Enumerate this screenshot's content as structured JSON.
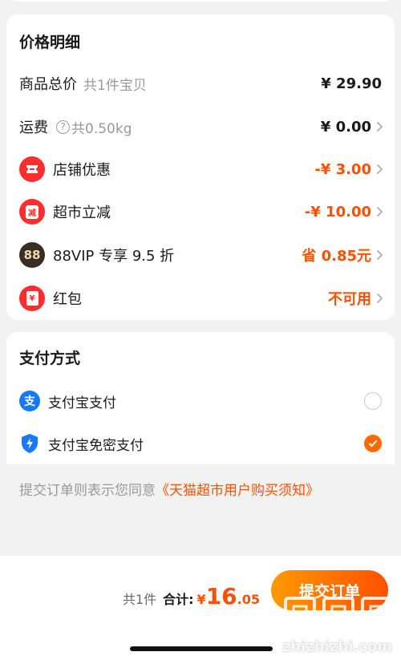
{
  "price_detail": {
    "title": "价格明细",
    "goods_total": {
      "label": "商品总价",
      "sub": "共1件宝贝",
      "amount": "¥ 29.90"
    },
    "shipping": {
      "label": "运费",
      "help_mark": "?",
      "sub": "共0.50kg",
      "amount": "¥ 0.00"
    },
    "store_discount": {
      "label": "店铺优惠",
      "amount": "-¥ 3.00",
      "icon": "ticket-icon"
    },
    "supermarket_discount": {
      "label": "超市立减",
      "badge": "减",
      "amount": "-¥ 10.00",
      "icon": "discount-badge-icon"
    },
    "vip": {
      "label": "88VIP 专享 9.5 折",
      "badge": "88",
      "amount": "省 0.85元",
      "icon": "88vip-icon"
    },
    "red_packet": {
      "label": "红包",
      "badge": "¥",
      "amount": "不可用",
      "icon": "red-packet-icon"
    }
  },
  "payment": {
    "title": "支付方式",
    "options": [
      {
        "label": "支付宝支付",
        "badge": "支",
        "selected": false,
        "icon": "alipay-icon"
      },
      {
        "label": "支付宝免密支付",
        "selected": true,
        "icon": "shield-lightning-icon"
      }
    ]
  },
  "agreement": {
    "prefix": "提交订单则表示您同意",
    "link": "《天猫超市用户购买须知》"
  },
  "footer": {
    "count": "共1件",
    "total_label": "合计:",
    "currency": "¥",
    "total_integer": "16",
    "total_decimal": ".05",
    "submit_label": "提交订单"
  },
  "watermark": {
    "glyph": "值",
    "text": "zhizhizhi.com"
  },
  "colors": {
    "accent": "#ff5000",
    "button_gradient_start": "#ff9a00",
    "button_gradient_end": "#ff5000",
    "icon_red": "#ff2d2d",
    "background": "#f2f2f2"
  }
}
